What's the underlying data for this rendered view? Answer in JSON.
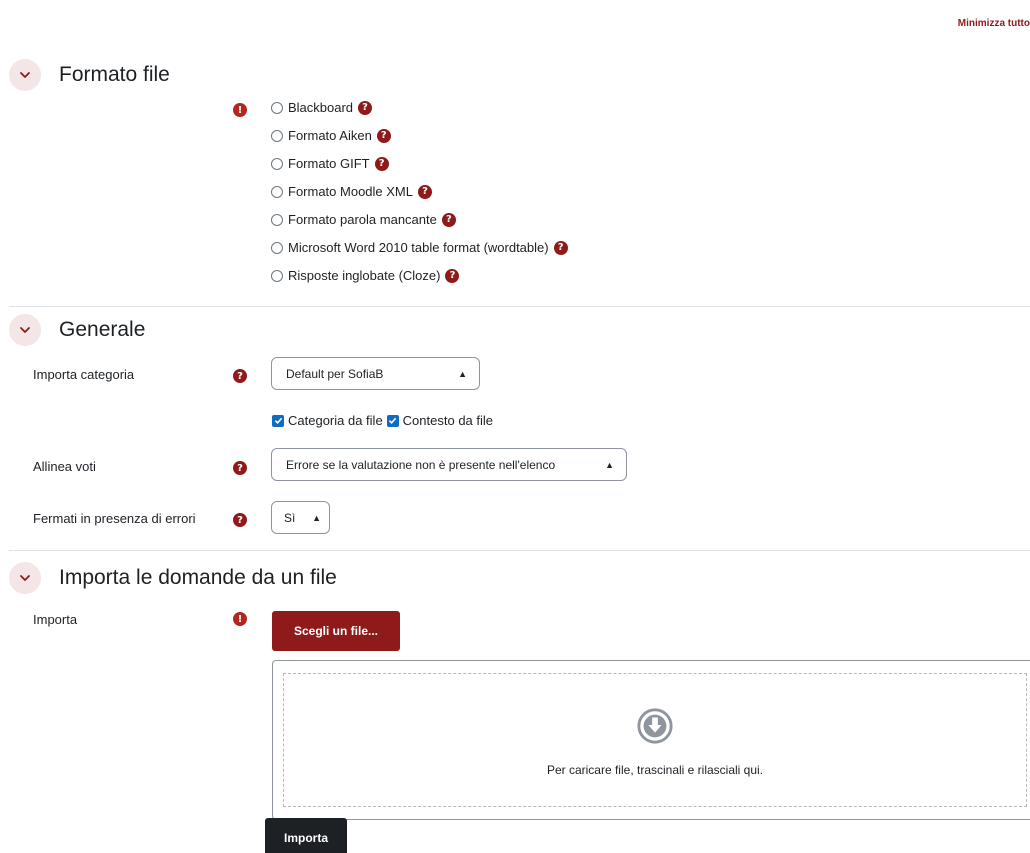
{
  "header": {
    "collapse_all": "Minimizza tutto"
  },
  "sections": {
    "format": {
      "title": "Formato file",
      "options": [
        {
          "label": "Blackboard",
          "checked": false
        },
        {
          "label": "Formato Aiken",
          "checked": false
        },
        {
          "label": "Formato GIFT",
          "checked": false
        },
        {
          "label": "Formato Moodle XML",
          "checked": false
        },
        {
          "label": "Formato parola mancante",
          "checked": false
        },
        {
          "label": "Microsoft Word 2010 table format (wordtable)",
          "checked": false
        },
        {
          "label": "Risposte inglobate (Cloze)",
          "checked": false
        }
      ]
    },
    "general": {
      "title": "Generale",
      "category_label": "Importa categoria",
      "category_value": "Default per SofiaB",
      "category_from_file": "Categoria da file",
      "context_from_file": "Contesto da file",
      "grades_label": "Allinea voti",
      "grades_value": "Errore se la valutazione non è presente nell'elenco",
      "stop_label": "Fermati in presenza di errori",
      "stop_value": "Sì"
    },
    "import": {
      "title": "Importa le domande da un file",
      "field_label": "Importa",
      "choose_button": "Scegli un file...",
      "drop_text": "Per caricare file, trascinali e rilasciali qui.",
      "submit_button": "Importa"
    }
  },
  "icons": {
    "required": "exclamation-icon",
    "help": "question-icon",
    "toggle": "chevron-down-icon",
    "drop": "arrow-down-circle-icon"
  },
  "colors": {
    "brand": "#8f1a1a",
    "required": "#b3271e",
    "checkbox": "#0f6cbf",
    "toggle_bg": "#f4e6e6",
    "submit_bg": "#1d2125"
  }
}
